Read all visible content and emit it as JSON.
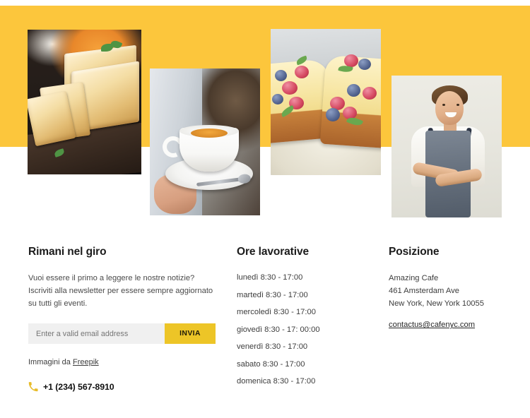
{
  "hero": {
    "band_color": "#fcc63c",
    "photos": [
      {
        "name": "sliced-cake-loaf-on-tray",
        "alt": "Sliced orange marmalade loaf cake on a dark baking tray"
      },
      {
        "name": "hands-holding-coffee-cup",
        "alt": "Hands holding a white cup of espresso on a saucer with spoon"
      },
      {
        "name": "cheesecake-slices-with-berries",
        "alt": "Slices of cheesecake topped with raspberries and blueberries"
      },
      {
        "name": "smiling-baker-portrait",
        "alt": "Smiling baker in a denim apron with arms crossed"
      }
    ]
  },
  "newsletter": {
    "heading": "Rimani nel giro",
    "body": "Vuoi essere il primo a leggere le nostre notizie? Iscriviti alla newsletter per essere sempre aggiornato su tutti gli eventi.",
    "input_value": "",
    "input_placeholder": "Enter a valid email address",
    "submit_label": "INVIA",
    "submit_color": "#edc527",
    "credit_prefix": "Immagini da ",
    "credit_link": "Freepik",
    "phone_icon": "phone-handset-icon",
    "phone_icon_color": "#e8bc2a",
    "phone": "+1 (234) 567-8910"
  },
  "hours": {
    "heading": "Ore lavorative",
    "items": [
      "lunedì 8:30 - 17:00",
      "martedì 8:30 - 17:00",
      "mercoledì 8:30 - 17:00",
      "giovedì 8:30 - 17: 00:00",
      "venerdì 8:30 - 17:00",
      "sabato 8:30 - 17:00",
      "domenica 8:30 - 17:00"
    ]
  },
  "location": {
    "heading": "Posizione",
    "name": "Amazing Cafe",
    "street": "461 Amsterdam Ave",
    "city": "New York, New York 10055",
    "email": "contactus@cafenyc.com"
  }
}
